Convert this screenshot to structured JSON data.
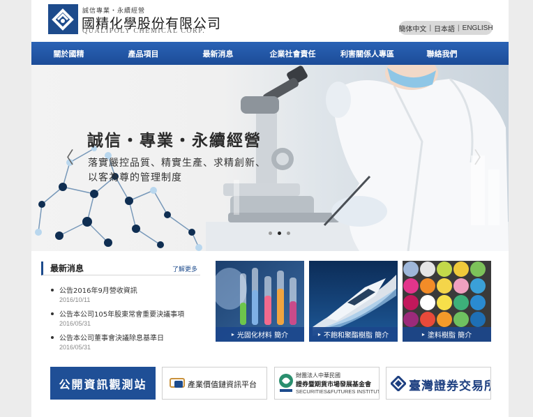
{
  "header": {
    "tagline": "誠信專業・永續經營",
    "company_cn": "國精化學股份有限公司",
    "company_en": "QUALIPOLY CHEMICAL CORP.",
    "languages": [
      "簡体中文",
      "日本語",
      "ENGLISH"
    ],
    "separator": "|"
  },
  "nav": {
    "items": [
      "關於國精",
      "產品項目",
      "最新消息",
      "企業社會責任",
      "利害關係人專區",
      "聯絡我們"
    ]
  },
  "hero": {
    "title": "誠信・專業・永續經營",
    "subtitle_line1": "落實嚴控品質、精實生產、求精創新、",
    "subtitle_line2": "以客為尊的管理制度",
    "prev_arrow": "〈",
    "next_arrow": "〉",
    "slide_count": 3,
    "active_slide": 1
  },
  "news": {
    "title": "最新消息",
    "more_label": "了解更多",
    "items": [
      {
        "text": "公告2016年9月營收資訊",
        "date": "2016/10/11"
      },
      {
        "text": "公告本公司105年股東常會重要決議事項",
        "date": "2016/05/31"
      },
      {
        "text": "公告本公司董事會決議除息基準日",
        "date": "2016/05/31"
      }
    ]
  },
  "products": {
    "arrow": "▸",
    "items": [
      {
        "label": "光固化材料 簡介"
      },
      {
        "label": "不飽和聚酯樹脂 簡介"
      },
      {
        "label": "塗料樹脂 簡介"
      }
    ]
  },
  "banners": {
    "mops": "公開資訊觀測站",
    "ic": "產業價值鏈資訊平台",
    "sfi_line1": "財團法人中華民國",
    "sfi_line2": "證券暨期貨市場發展基金會",
    "sfi_line3": "SECURITIES&FUTURES INSTITUTE",
    "twse": "臺灣證券交易所"
  },
  "colors": {
    "brand_blue": "#1d4b8c",
    "nav_blue": "#2a62b5"
  }
}
